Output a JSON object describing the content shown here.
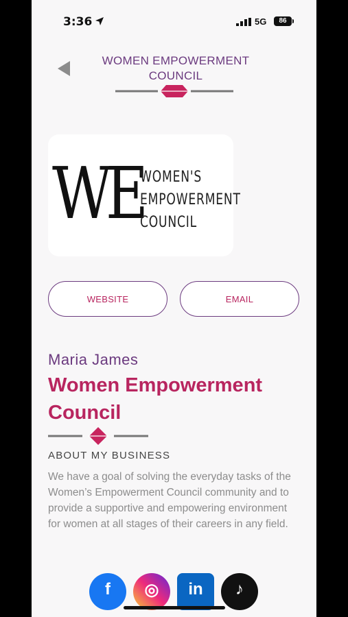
{
  "status_bar": {
    "time": "3:36",
    "network": "5G",
    "battery": "86"
  },
  "header": {
    "title_line1": "WOMEN EMPOWERMENT",
    "title_line2": "COUNCIL"
  },
  "logo": {
    "monogram": "WE",
    "text_line1": "WOMEN'S",
    "text_line2": "EMPOWERMENT",
    "text_line3": "COUNCIL"
  },
  "buttons": {
    "website": "WEBSITE",
    "email": "EMAIL"
  },
  "profile": {
    "name": "Maria James",
    "business_line1": "Women Empowerment",
    "business_line2": "Council",
    "about_heading": "ABOUT MY BUSINESS",
    "about_text": "We have a goal of solving the everyday tasks of the Women’s Empowerment Council community and to provide a supportive and empowering environment for women at all stages of their careers in any field."
  },
  "social": [
    {
      "name": "facebook-icon",
      "glyph": "f"
    },
    {
      "name": "instagram-icon",
      "glyph": "◎"
    },
    {
      "name": "linkedin-icon",
      "glyph": "in"
    },
    {
      "name": "tiktok-icon",
      "glyph": "♪"
    }
  ],
  "colors": {
    "accent": "#b8255f",
    "purple": "#6b3a7f",
    "background": "#f8f7f8"
  }
}
